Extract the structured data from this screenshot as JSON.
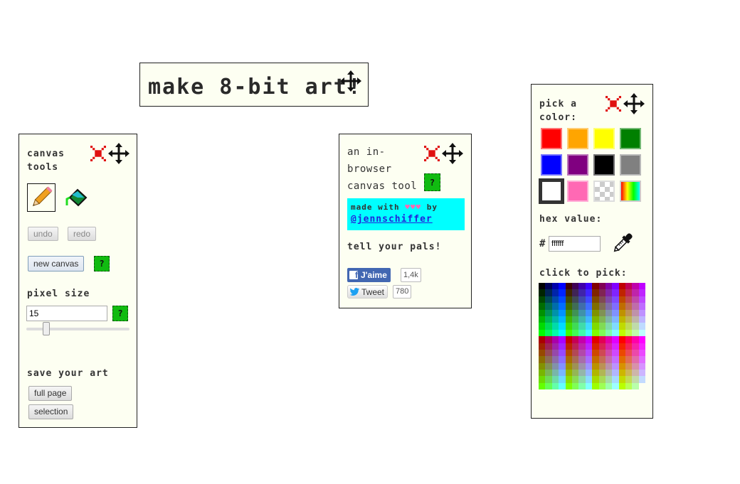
{
  "title_banner": {
    "text": "make 8-bit art!"
  },
  "canvas_tools": {
    "title": "canvas tools",
    "tools": [
      {
        "name": "pencil",
        "selected": true
      },
      {
        "name": "paint-bucket",
        "selected": false
      }
    ],
    "undo_label": "undo",
    "redo_label": "redo",
    "new_canvas_label": "new canvas",
    "help_label": "?",
    "pixel_size_heading": "pixel size",
    "pixel_size_value": "15",
    "pixel_size_slider_fraction": 0.17,
    "save_heading": "save your art",
    "full_page_label": "full page",
    "selection_label": "selection"
  },
  "about": {
    "line1": "an in-",
    "line2": "browser",
    "line3": "canvas tool",
    "help_label": "?",
    "made_with": "made with",
    "hearts": "♥♥♥",
    "by": "by",
    "author_link": "@jennschiffer",
    "share_heading": "tell your pals!",
    "facebook_label": "J'aime",
    "facebook_count": "1,4k",
    "tweet_label": "Tweet",
    "tweet_count": "780"
  },
  "color_picker": {
    "title_line1": "pick a",
    "title_line2": "color:",
    "swatches": [
      {
        "name": "red",
        "color": "#ff0000"
      },
      {
        "name": "orange",
        "color": "#ffa500"
      },
      {
        "name": "yellow",
        "color": "#ffff00"
      },
      {
        "name": "green",
        "color": "#008000"
      },
      {
        "name": "blue",
        "color": "#0000ff"
      },
      {
        "name": "purple",
        "color": "#800080"
      },
      {
        "name": "black",
        "color": "#000000"
      },
      {
        "name": "gray",
        "color": "#808080"
      },
      {
        "name": "white",
        "color": "#ffffff",
        "selected": true
      },
      {
        "name": "pink",
        "color": "#ff69b4"
      },
      {
        "name": "transparent",
        "color": "transparent"
      },
      {
        "name": "rainbow",
        "color": "rainbow"
      }
    ],
    "hex_heading": "hex value:",
    "hash": "#",
    "hex_value": "ffffff",
    "click_to_pick_heading": "click to pick:"
  }
}
